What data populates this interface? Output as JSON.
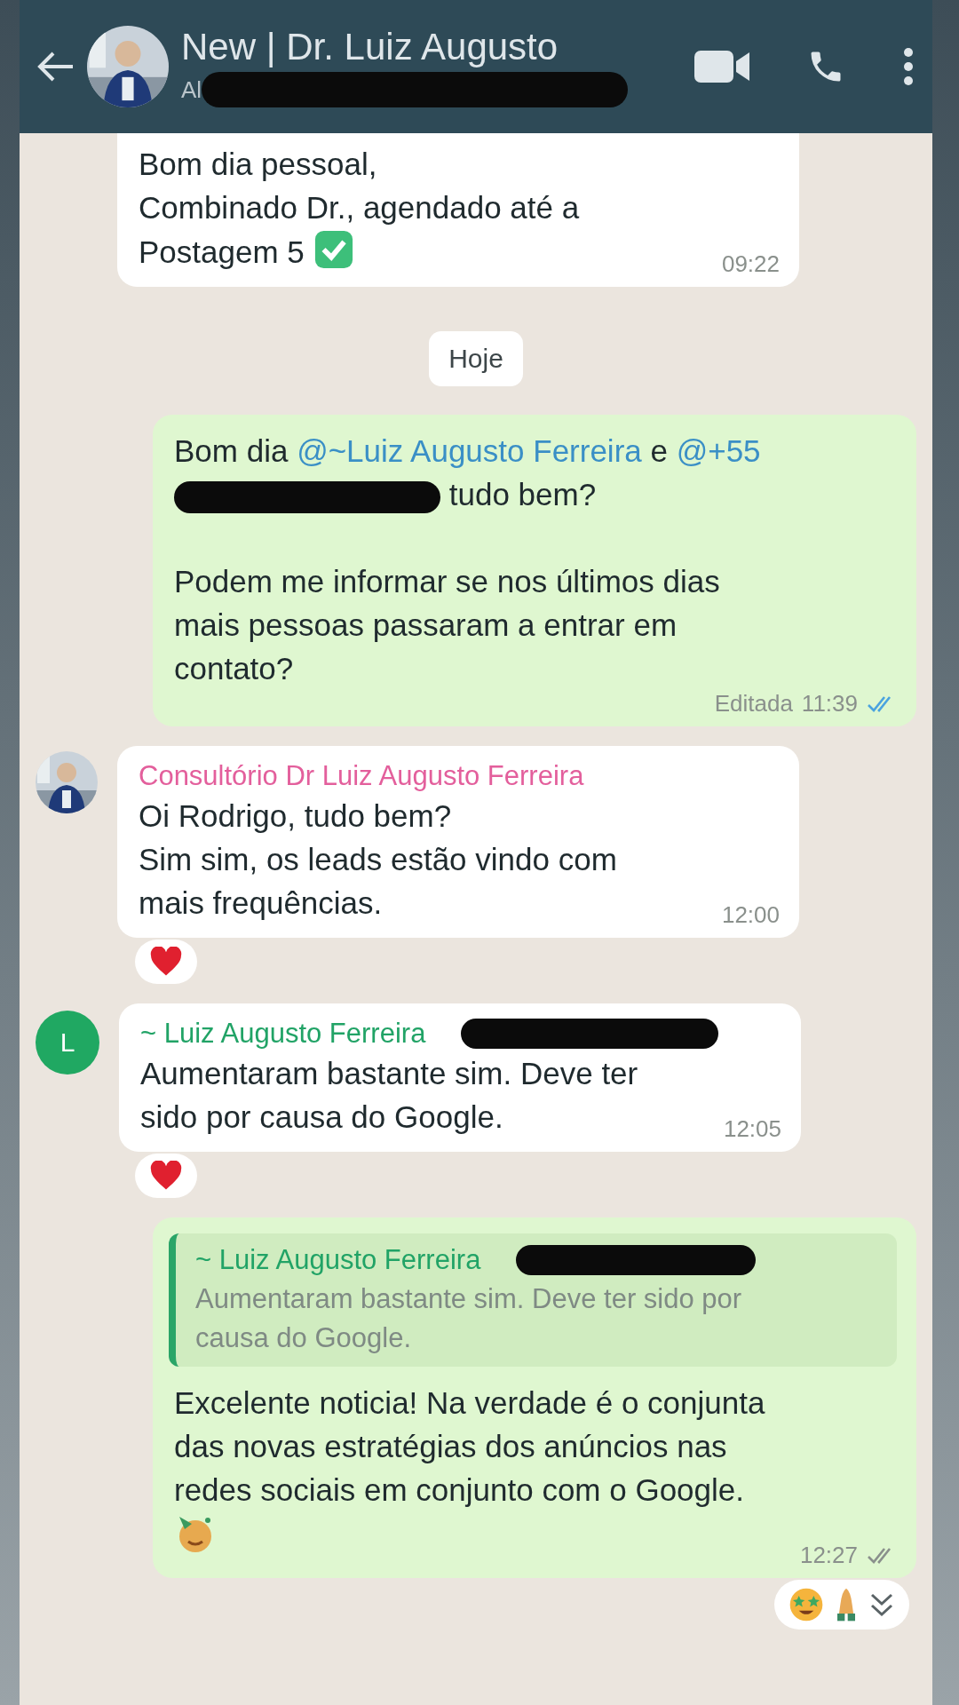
{
  "header": {
    "title": "New | Dr. Luiz Augusto",
    "subtitle": "Al",
    "subtitle_redacted": true
  },
  "messages": [
    {
      "kind": "incoming",
      "cut_top": true,
      "segments": [
        {
          "kind": "text",
          "text": "Bom dia pessoal,\nCombinado Dr., agendado até a\nPostagem 5 "
        },
        {
          "kind": "check_emoji"
        }
      ],
      "time": "09:22"
    },
    {
      "kind": "date",
      "text": "Hoje"
    },
    {
      "kind": "outgoing",
      "segments": [
        {
          "kind": "text",
          "text": "Bom dia "
        },
        {
          "kind": "mention",
          "text": "@~Luiz Augusto Ferreira"
        },
        {
          "kind": "text",
          "text": " e "
        },
        {
          "kind": "mention",
          "text": "@+55"
        },
        {
          "kind": "break"
        },
        {
          "kind": "redaction"
        },
        {
          "kind": "text",
          "text": " tudo bem?\n\nPodem me informar se nos últimos dias\nmais pessoas passaram a entrar em\ncontato?"
        }
      ],
      "edited": "Editada",
      "time": "11:39",
      "read": true
    },
    {
      "kind": "incoming",
      "sender": {
        "name": "Consultório Dr Luiz Augusto Ferreira",
        "color": "#e35f9c"
      },
      "avatar": {
        "kind": "picture"
      },
      "segments": [
        {
          "kind": "text",
          "text": "Oi Rodrigo, tudo bem?\nSim sim, os leads estão vindo com\nmais frequências."
        }
      ],
      "time": "12:00",
      "reactions": [
        {
          "kind": "heart"
        }
      ]
    },
    {
      "kind": "incoming",
      "sender": {
        "name": "~ Luiz Augusto Ferreira",
        "color": "#21a366",
        "redacted": true
      },
      "avatar": {
        "kind": "letter",
        "text": "L"
      },
      "segments": [
        {
          "kind": "text",
          "text": "Aumentaram bastante sim. Deve ter\nsido por causa do Google."
        }
      ],
      "time": "12:05",
      "reactions": [
        {
          "kind": "heart"
        }
      ]
    },
    {
      "kind": "outgoing",
      "quote": {
        "name": "~ Luiz Augusto Ferreira",
        "redacted": true,
        "text": "Aumentaram bastante sim. Deve ter sido por\ncausa do Google."
      },
      "segments": [
        {
          "kind": "text",
          "text": "Excelente noticia! Na verdade é o conjunta\ndas novas estratégias dos anúncios nas\nredes sociais em conjunto com o Google.\n"
        },
        {
          "kind": "party_emoji"
        }
      ],
      "time": "12:27",
      "read": false,
      "reactions": [
        {
          "kind": "star_eyes"
        },
        {
          "kind": "pray"
        }
      ],
      "scroll_button": true
    }
  ]
}
